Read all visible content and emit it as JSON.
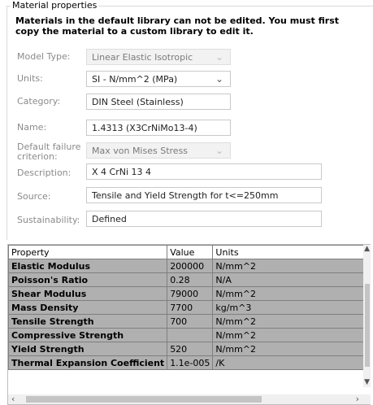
{
  "group_title": "Material properties",
  "notice": "Materials in the default library can not be edited. You must first copy the material to a custom library to edit it.",
  "fields": {
    "model_type": {
      "label": "Model Type:",
      "value": "Linear Elastic Isotropic",
      "disabled": true
    },
    "units": {
      "label": "Units:",
      "value": "SI - N/mm^2 (MPa)"
    },
    "category": {
      "label": "Category:",
      "value": "DIN Steel (Stainless)"
    },
    "name": {
      "label": "Name:",
      "value": "1.4313 (X3CrNiMo13-4)"
    },
    "failure": {
      "label": "Default failure criterion:",
      "value": "Max von Mises Stress",
      "disabled": true
    },
    "description": {
      "label": "Description:",
      "value": "X 4 CrNi 13 4"
    },
    "source": {
      "label": "Source:",
      "value": "Tensile and Yield Strength for t<=250mm"
    },
    "sustainability": {
      "label": "Sustainability:",
      "value": "Defined"
    }
  },
  "table": {
    "headers": [
      "Property",
      "Value",
      "Units"
    ],
    "rows": [
      [
        "Elastic Modulus",
        "200000",
        "N/mm^2"
      ],
      [
        "Poisson's Ratio",
        "0.28",
        "N/A"
      ],
      [
        "Shear Modulus",
        "79000",
        "N/mm^2"
      ],
      [
        "Mass Density",
        "7700",
        "kg/m^3"
      ],
      [
        "Tensile Strength",
        "700",
        "N/mm^2"
      ],
      [
        "Compressive Strength",
        "",
        "N/mm^2"
      ],
      [
        "Yield Strength",
        "520",
        "N/mm^2"
      ],
      [
        "Thermal Expansion Coefficient",
        "1.1e-005",
        "/K"
      ]
    ]
  },
  "icons": {
    "dropdown": "chevron-down-icon",
    "scroll_up": "scroll-up-arrow-icon",
    "scroll_down": "scroll-down-arrow-icon",
    "scroll_left": "scroll-left-arrow-icon",
    "scroll_right": "scroll-right-arrow-icon"
  },
  "colors": {
    "grid_row_bg": "#b0b0b0",
    "label_text": "#8a8a8a",
    "disabled_bg": "#f2f2f2"
  }
}
